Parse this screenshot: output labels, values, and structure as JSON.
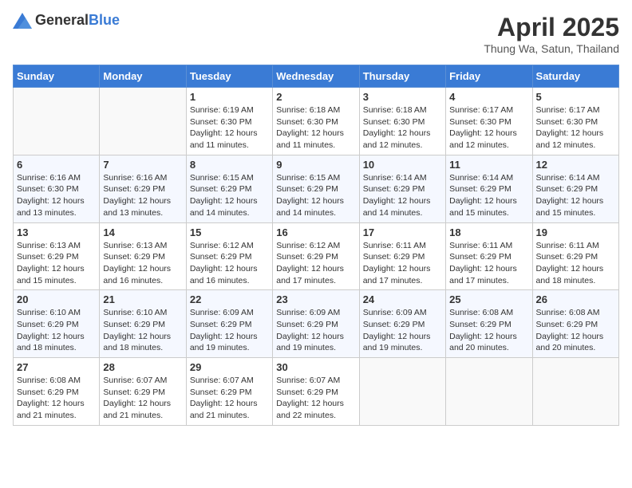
{
  "header": {
    "logo_general": "General",
    "logo_blue": "Blue",
    "month_year": "April 2025",
    "location": "Thung Wa, Satun, Thailand"
  },
  "days_of_week": [
    "Sunday",
    "Monday",
    "Tuesday",
    "Wednesday",
    "Thursday",
    "Friday",
    "Saturday"
  ],
  "weeks": [
    [
      {
        "day": "",
        "info": ""
      },
      {
        "day": "",
        "info": ""
      },
      {
        "day": "1",
        "info": "Sunrise: 6:19 AM\nSunset: 6:30 PM\nDaylight: 12 hours and 11 minutes."
      },
      {
        "day": "2",
        "info": "Sunrise: 6:18 AM\nSunset: 6:30 PM\nDaylight: 12 hours and 11 minutes."
      },
      {
        "day": "3",
        "info": "Sunrise: 6:18 AM\nSunset: 6:30 PM\nDaylight: 12 hours and 12 minutes."
      },
      {
        "day": "4",
        "info": "Sunrise: 6:17 AM\nSunset: 6:30 PM\nDaylight: 12 hours and 12 minutes."
      },
      {
        "day": "5",
        "info": "Sunrise: 6:17 AM\nSunset: 6:30 PM\nDaylight: 12 hours and 12 minutes."
      }
    ],
    [
      {
        "day": "6",
        "info": "Sunrise: 6:16 AM\nSunset: 6:30 PM\nDaylight: 12 hours and 13 minutes."
      },
      {
        "day": "7",
        "info": "Sunrise: 6:16 AM\nSunset: 6:29 PM\nDaylight: 12 hours and 13 minutes."
      },
      {
        "day": "8",
        "info": "Sunrise: 6:15 AM\nSunset: 6:29 PM\nDaylight: 12 hours and 14 minutes."
      },
      {
        "day": "9",
        "info": "Sunrise: 6:15 AM\nSunset: 6:29 PM\nDaylight: 12 hours and 14 minutes."
      },
      {
        "day": "10",
        "info": "Sunrise: 6:14 AM\nSunset: 6:29 PM\nDaylight: 12 hours and 14 minutes."
      },
      {
        "day": "11",
        "info": "Sunrise: 6:14 AM\nSunset: 6:29 PM\nDaylight: 12 hours and 15 minutes."
      },
      {
        "day": "12",
        "info": "Sunrise: 6:14 AM\nSunset: 6:29 PM\nDaylight: 12 hours and 15 minutes."
      }
    ],
    [
      {
        "day": "13",
        "info": "Sunrise: 6:13 AM\nSunset: 6:29 PM\nDaylight: 12 hours and 15 minutes."
      },
      {
        "day": "14",
        "info": "Sunrise: 6:13 AM\nSunset: 6:29 PM\nDaylight: 12 hours and 16 minutes."
      },
      {
        "day": "15",
        "info": "Sunrise: 6:12 AM\nSunset: 6:29 PM\nDaylight: 12 hours and 16 minutes."
      },
      {
        "day": "16",
        "info": "Sunrise: 6:12 AM\nSunset: 6:29 PM\nDaylight: 12 hours and 17 minutes."
      },
      {
        "day": "17",
        "info": "Sunrise: 6:11 AM\nSunset: 6:29 PM\nDaylight: 12 hours and 17 minutes."
      },
      {
        "day": "18",
        "info": "Sunrise: 6:11 AM\nSunset: 6:29 PM\nDaylight: 12 hours and 17 minutes."
      },
      {
        "day": "19",
        "info": "Sunrise: 6:11 AM\nSunset: 6:29 PM\nDaylight: 12 hours and 18 minutes."
      }
    ],
    [
      {
        "day": "20",
        "info": "Sunrise: 6:10 AM\nSunset: 6:29 PM\nDaylight: 12 hours and 18 minutes."
      },
      {
        "day": "21",
        "info": "Sunrise: 6:10 AM\nSunset: 6:29 PM\nDaylight: 12 hours and 18 minutes."
      },
      {
        "day": "22",
        "info": "Sunrise: 6:09 AM\nSunset: 6:29 PM\nDaylight: 12 hours and 19 minutes."
      },
      {
        "day": "23",
        "info": "Sunrise: 6:09 AM\nSunset: 6:29 PM\nDaylight: 12 hours and 19 minutes."
      },
      {
        "day": "24",
        "info": "Sunrise: 6:09 AM\nSunset: 6:29 PM\nDaylight: 12 hours and 19 minutes."
      },
      {
        "day": "25",
        "info": "Sunrise: 6:08 AM\nSunset: 6:29 PM\nDaylight: 12 hours and 20 minutes."
      },
      {
        "day": "26",
        "info": "Sunrise: 6:08 AM\nSunset: 6:29 PM\nDaylight: 12 hours and 20 minutes."
      }
    ],
    [
      {
        "day": "27",
        "info": "Sunrise: 6:08 AM\nSunset: 6:29 PM\nDaylight: 12 hours and 21 minutes."
      },
      {
        "day": "28",
        "info": "Sunrise: 6:07 AM\nSunset: 6:29 PM\nDaylight: 12 hours and 21 minutes."
      },
      {
        "day": "29",
        "info": "Sunrise: 6:07 AM\nSunset: 6:29 PM\nDaylight: 12 hours and 21 minutes."
      },
      {
        "day": "30",
        "info": "Sunrise: 6:07 AM\nSunset: 6:29 PM\nDaylight: 12 hours and 22 minutes."
      },
      {
        "day": "",
        "info": ""
      },
      {
        "day": "",
        "info": ""
      },
      {
        "day": "",
        "info": ""
      }
    ]
  ]
}
